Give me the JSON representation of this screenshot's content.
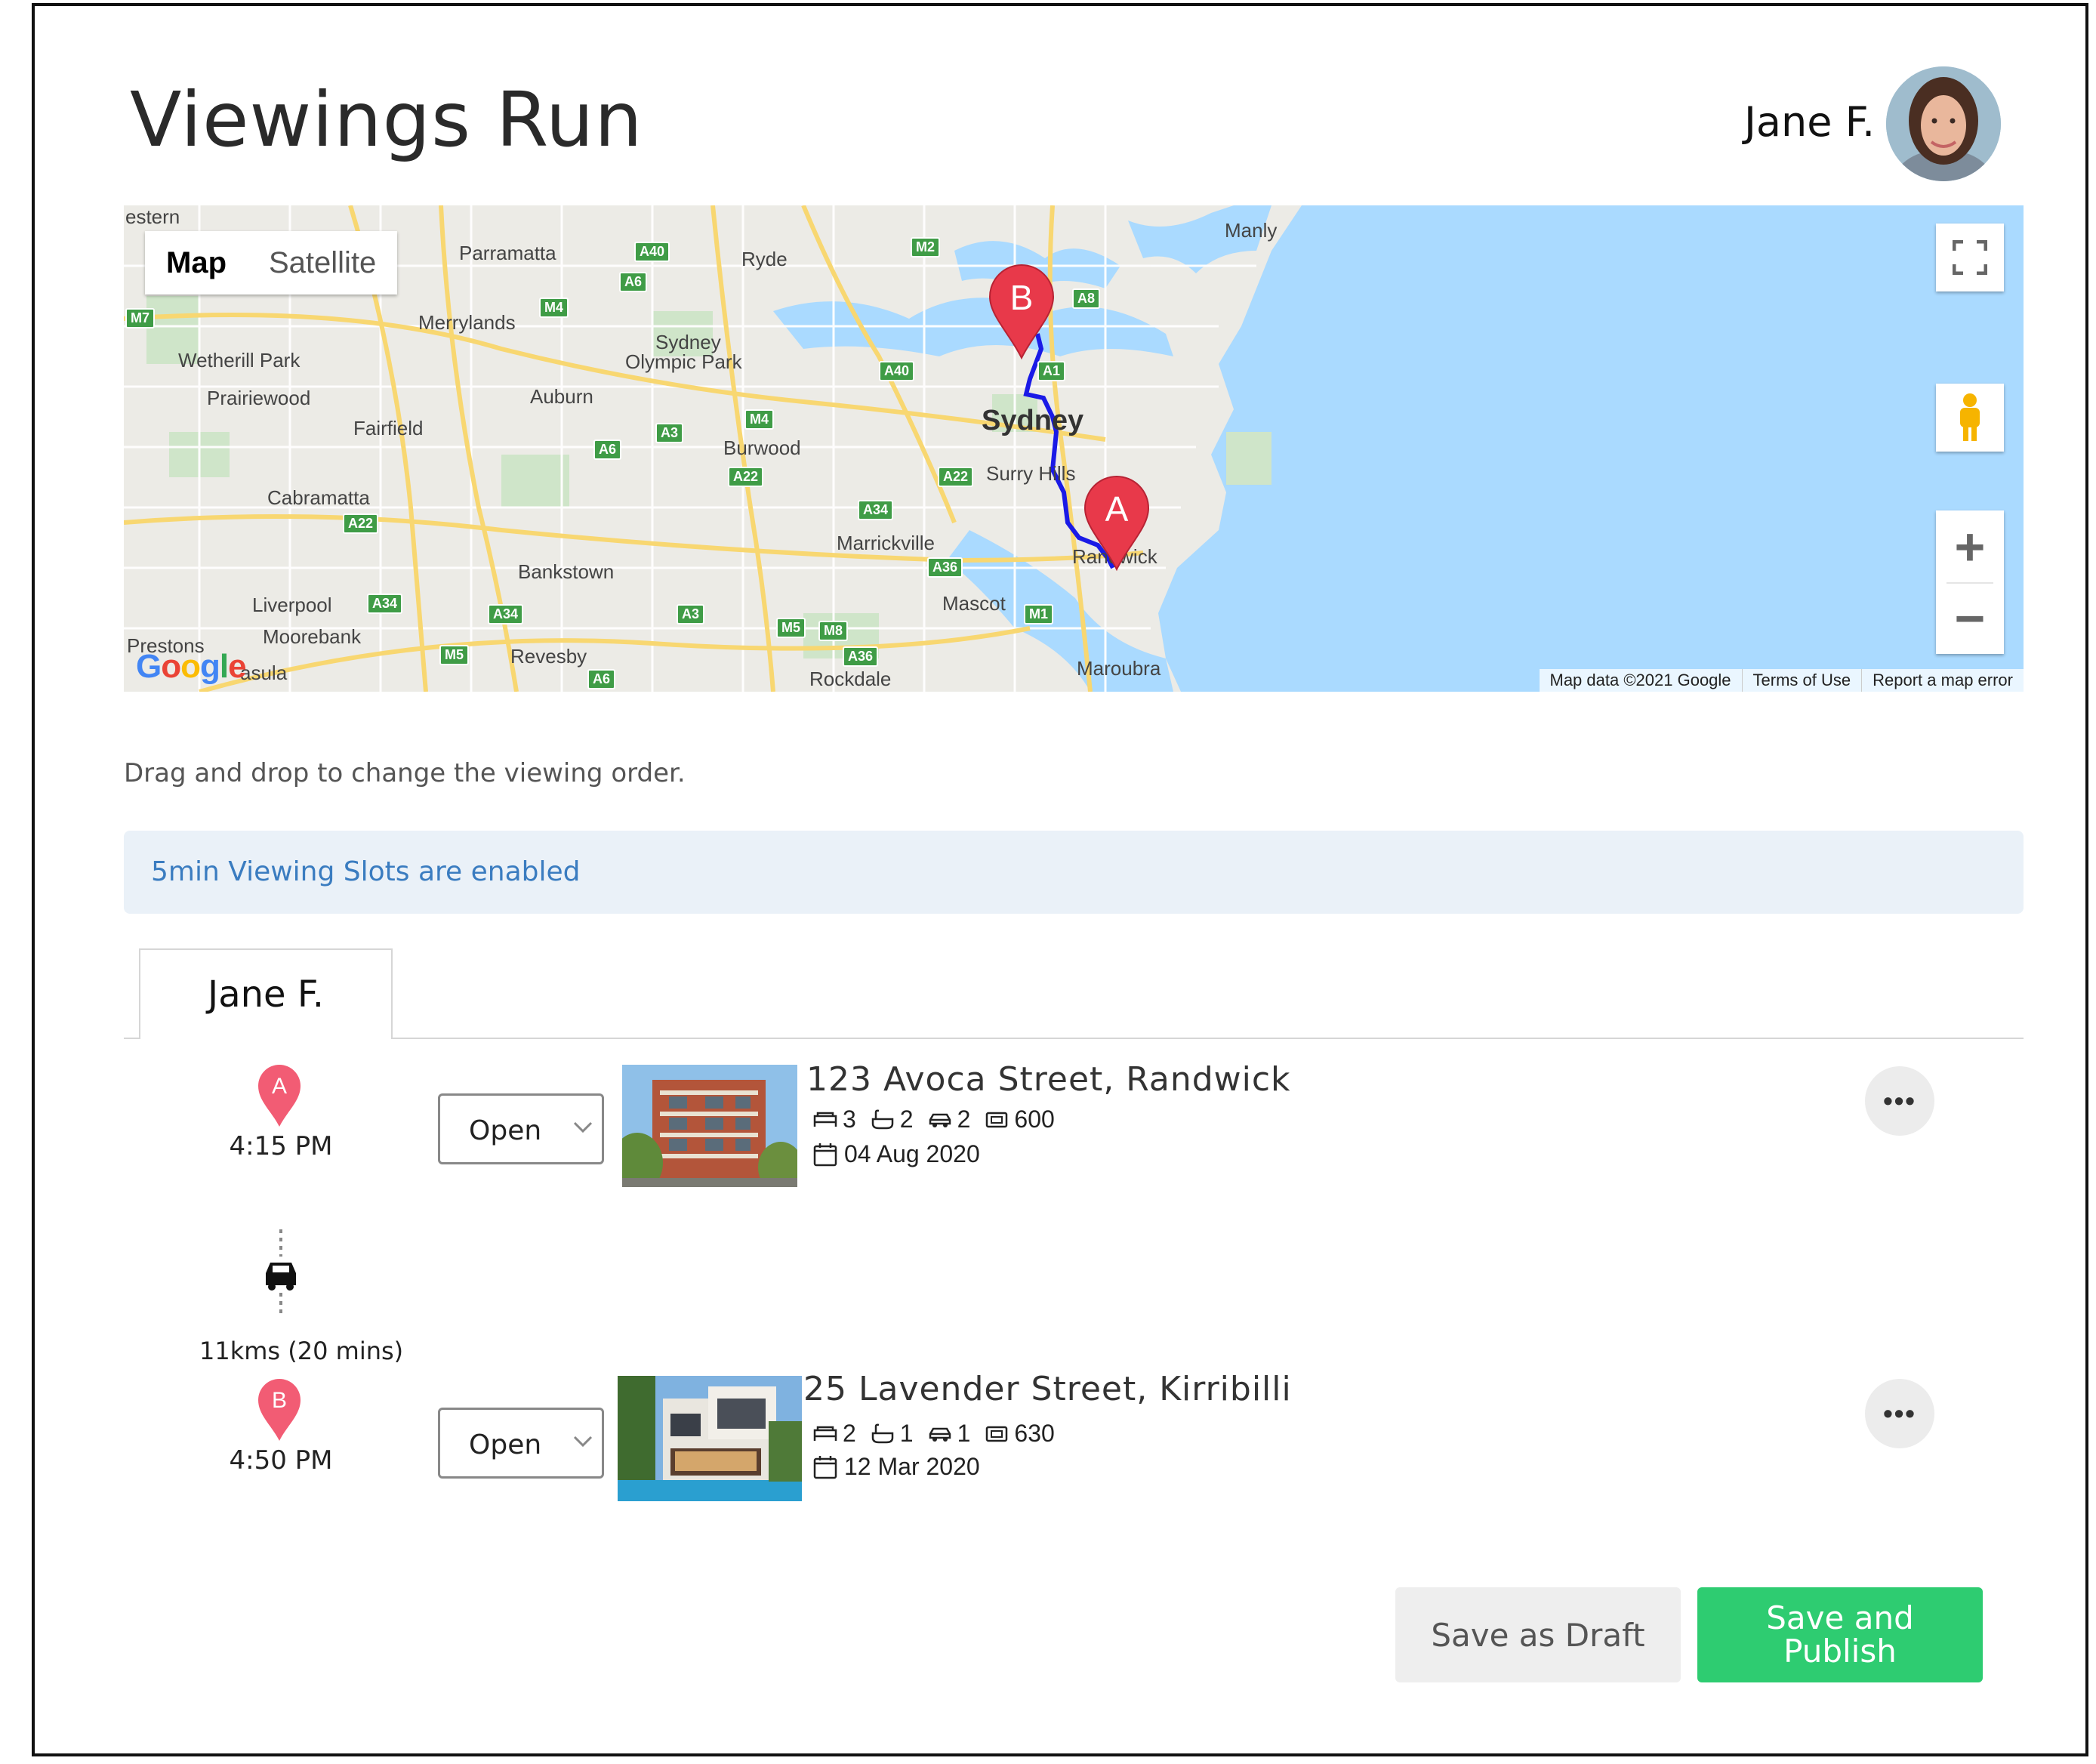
{
  "header": {
    "title": "Viewings Run",
    "user_name": "Jane F."
  },
  "map": {
    "type_map": "Map",
    "type_satellite": "Satellite",
    "footer_data": "Map data ©2021 Google",
    "footer_terms": "Terms of Use",
    "footer_report": "Report a map error",
    "google": "Google",
    "city": "Sydney",
    "places": {
      "western": "estern",
      "parramatta": "Parramatta",
      "ryde": "Ryde",
      "manly": "Manly",
      "merrylands": "Merrylands",
      "wetherill": "Wetherill Park",
      "sydney_olympic": "Sydney",
      "olympic_park": "Olympic Park",
      "prairiewood": "Prairiewood",
      "auburn": "Auburn",
      "fairfield": "Fairfield",
      "burwood": "Burwood",
      "surry_hills": "Surry Hills",
      "cabramatta": "Cabramatta",
      "marrickville": "Marrickville",
      "randwick": "Randwick",
      "bankstown": "Bankstown",
      "liverpool": "Liverpool",
      "mascot": "Mascot",
      "moorebank": "Moorebank",
      "prestons": "Prestons",
      "revesby": "Revesby",
      "maroubra": "Maroubra",
      "rockdale": "Rockdale",
      "peninsula": "asula"
    },
    "shields": {
      "m7": "M7",
      "a40a": "A40",
      "a6a": "A6",
      "m2": "M2",
      "a8": "A8",
      "m4a": "M4",
      "a40b": "A40",
      "a1": "A1",
      "m4b": "M4",
      "a3a": "A3",
      "a6b": "A6",
      "a22a": "A22",
      "a22b": "A22",
      "a22c": "A22",
      "a34a": "A34",
      "a36a": "A36",
      "a34b": "A34",
      "a34c": "A34",
      "a3b": "A3",
      "m5a": "M5",
      "m8": "M8",
      "m1": "M1",
      "m5b": "M5",
      "a36b": "A36",
      "a6c": "A6"
    },
    "markers": {
      "a": "A",
      "b": "B"
    }
  },
  "hint": "Drag and drop to change the viewing order.",
  "banner": "5min Viewing Slots are enabled",
  "tab": {
    "label": "Jane F."
  },
  "viewings": [
    {
      "marker": "A",
      "time": "4:15 PM",
      "status": "Open",
      "address": "123 Avoca Street, Randwick",
      "beds": "3",
      "baths": "2",
      "cars": "2",
      "area": "600",
      "date": "04 Aug 2020"
    },
    {
      "marker": "B",
      "time": "4:50 PM",
      "status": "Open",
      "address": "25 Lavender Street, Kirribilli",
      "beds": "2",
      "baths": "1",
      "cars": "1",
      "area": "630",
      "date": "12 Mar 2020"
    }
  ],
  "travel": "11kms (20 mins)",
  "actions": {
    "draft": "Save as Draft",
    "publish": "Save and Publish"
  },
  "colors": {
    "primary": "#2ecc71",
    "marker": "#e8394a",
    "route": "#1a1ae6",
    "water": "#aadaff",
    "banner_text": "#3a7cc0"
  }
}
